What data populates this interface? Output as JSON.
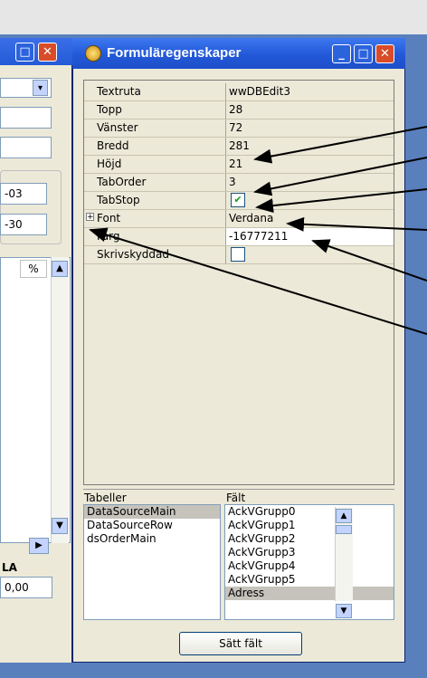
{
  "left_window": {
    "values": [
      "-03",
      "-30"
    ],
    "percent_header": "%",
    "footer_label": "LA",
    "footer_value": "0,00"
  },
  "window": {
    "title": "Formuläregenskaper",
    "controls": {
      "minimize": "_",
      "maximize": "□",
      "close": "✕"
    }
  },
  "properties": [
    {
      "name": "Textruta",
      "value": "wwDBEdit3"
    },
    {
      "name": "Topp",
      "value": "28"
    },
    {
      "name": "Vänster",
      "value": "72"
    },
    {
      "name": "Bredd",
      "value": "281"
    },
    {
      "name": "Höjd",
      "value": "21"
    },
    {
      "name": "TabOrder",
      "value": "3"
    },
    {
      "name": "TabStop",
      "value": "✔",
      "type": "checkbox",
      "checked": true
    },
    {
      "name": "Font",
      "value": "Verdana",
      "expander": "+"
    },
    {
      "name": "Färg",
      "value": "-16777211"
    },
    {
      "name": "Skrivskyddad",
      "value": "",
      "type": "checkbox",
      "checked": false
    }
  ],
  "tables_label": "Tabeller",
  "tables": [
    "DataSourceMain",
    "DataSourceRow",
    "dsOrderMain"
  ],
  "fields_label": "Fält",
  "fields": [
    "AckVGrupp0",
    "AckVGrupp1",
    "AckVGrupp2",
    "AckVGrupp3",
    "AckVGrupp4",
    "AckVGrupp5",
    "Adress"
  ],
  "set_field_button": "Sätt fält",
  "colors": {
    "titlebar": "#2258d8",
    "face": "#ece9d8",
    "selection": "#c6c3bc",
    "desktop": "#5a7fbd"
  }
}
